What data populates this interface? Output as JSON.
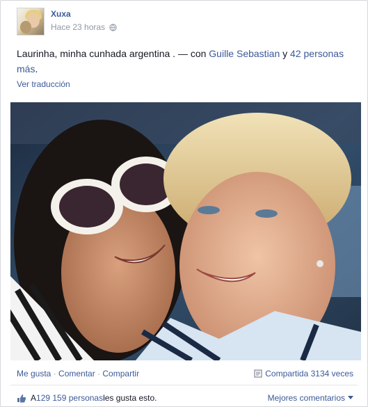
{
  "post": {
    "author": "Xuxa",
    "time": "Hace 23 horas",
    "text_main": "Laurinha, minha cunhada argentina . — con ",
    "tagged_person": "Guille Sebastian",
    "text_and": " y ",
    "tagged_others": "42 personas más",
    "text_end": ".",
    "translate_label": "Ver traducción"
  },
  "actions": {
    "like": "Me gusta",
    "sep1": " · ",
    "comment": "Comentar",
    "sep2": " · ",
    "share": "Compartir",
    "shared_count": "Compartida 3134 veces"
  },
  "likes": {
    "prefix": "A ",
    "people": "129 159 personas",
    "suffix": " les gusta esto.",
    "sort_label": "Mejores comentarios"
  },
  "icons": {
    "privacy": "globe-icon",
    "share": "share-icon",
    "like": "thumbs-up-icon",
    "dropdown": "caret-down-icon"
  },
  "colors": {
    "link": "#3b5998",
    "muted": "#9197a3",
    "text": "#141823"
  }
}
